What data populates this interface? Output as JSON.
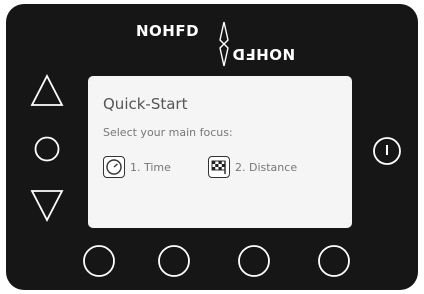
{
  "logo": {
    "word_top": "NOHFD",
    "word_bottom": "NOHFD"
  },
  "screen": {
    "title": "Quick-Start",
    "subtitle": "Select your main focus:",
    "options": [
      {
        "label": "1. Time",
        "icon": "stopwatch-icon"
      },
      {
        "label": "2. Distance",
        "icon": "checkered-flag-icon"
      }
    ]
  },
  "buttons": {
    "up": "up-triangle-icon",
    "ok": "circle-icon",
    "down": "down-triangle-icon",
    "power": "power-icon",
    "bottom": [
      "circle-icon",
      "circle-icon",
      "circle-icon",
      "circle-icon"
    ]
  },
  "colors": {
    "device": "#161616",
    "screen": "#f5f5f5",
    "text": "#777777"
  }
}
